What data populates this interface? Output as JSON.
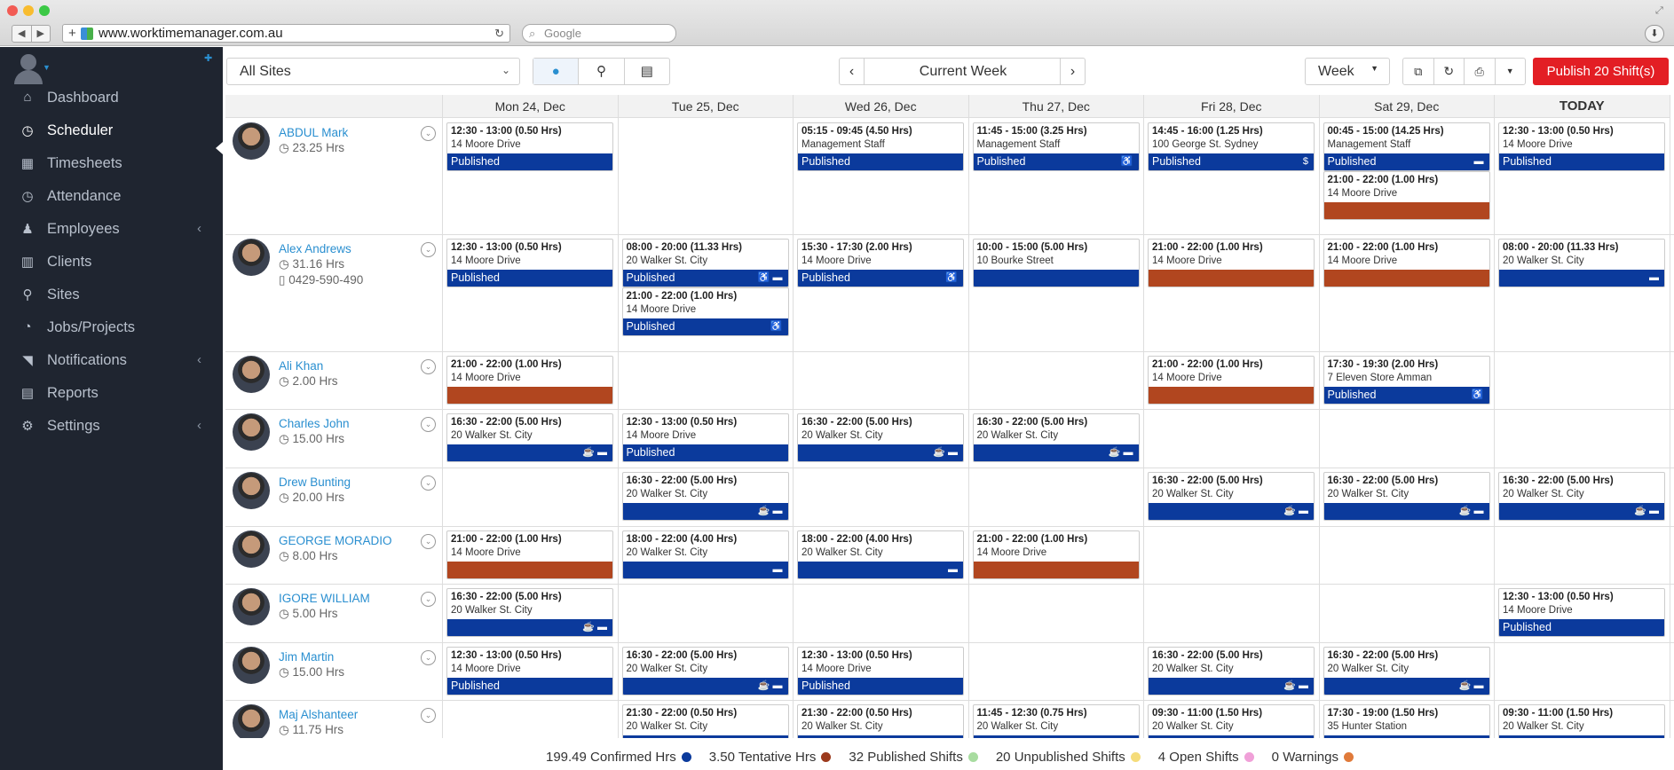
{
  "browser": {
    "url": "www.worktimemanager.com.au",
    "search_placeholder": "Google"
  },
  "sidebar": {
    "items": [
      {
        "label": "Dashboard",
        "icon": "dashboard-icon",
        "glyph": "⌂",
        "active": false,
        "chevron": false
      },
      {
        "label": "Scheduler",
        "icon": "clock-icon",
        "glyph": "◷",
        "active": true,
        "chevron": false
      },
      {
        "label": "Timesheets",
        "icon": "calendar-icon",
        "glyph": "▦",
        "active": false,
        "chevron": false
      },
      {
        "label": "Attendance",
        "icon": "clock-icon",
        "glyph": "◷",
        "active": false,
        "chevron": false
      },
      {
        "label": "Employees",
        "icon": "person-icon",
        "glyph": "♟",
        "active": false,
        "chevron": true
      },
      {
        "label": "Clients",
        "icon": "bank-icon",
        "glyph": "▥",
        "active": false,
        "chevron": false
      },
      {
        "label": "Sites",
        "icon": "map-pin-icon",
        "glyph": "⚲",
        "active": false,
        "chevron": false
      },
      {
        "label": "Jobs/Projects",
        "icon": "dashboard-icon",
        "glyph": "◔",
        "active": false,
        "chevron": false
      },
      {
        "label": "Notifications",
        "icon": "rss-icon",
        "glyph": "◥",
        "active": false,
        "chevron": true
      },
      {
        "label": "Reports",
        "icon": "grid-icon",
        "glyph": "▤",
        "active": false,
        "chevron": false
      },
      {
        "label": "Settings",
        "icon": "gear-icon",
        "glyph": "⚙",
        "active": false,
        "chevron": true
      }
    ]
  },
  "toolbar": {
    "sites": "All Sites",
    "week_nav": "Current Week",
    "view": "Week",
    "publish": "Publish 20 Shift(s)"
  },
  "days": [
    "Mon 24, Dec",
    "Tue 25, Dec",
    "Wed 26, Dec",
    "Thu 27, Dec",
    "Fri 28, Dec",
    "Sat 29, Dec",
    "TODAY"
  ],
  "employees": [
    {
      "name": "ABDUL Mark",
      "hours": "23.25 Hrs",
      "phone": ""
    },
    {
      "name": "Alex Andrews",
      "hours": "31.16 Hrs",
      "phone": "0429-590-490"
    },
    {
      "name": "Ali Khan",
      "hours": "2.00 Hrs",
      "phone": ""
    },
    {
      "name": "Charles John",
      "hours": "15.00 Hrs",
      "phone": ""
    },
    {
      "name": "Drew Bunting",
      "hours": "20.00 Hrs",
      "phone": ""
    },
    {
      "name": "GEORGE MORADIO",
      "hours": "8.00 Hrs",
      "phone": ""
    },
    {
      "name": "IGORE WILLIAM",
      "hours": "5.00 Hrs",
      "phone": ""
    },
    {
      "name": "Jim Martin",
      "hours": "15.00 Hrs",
      "phone": ""
    },
    {
      "name": "Maj Alshanteer",
      "hours": "11.75 Hrs",
      "phone": ""
    }
  ],
  "shifts": [
    {
      "row": 0,
      "day": 0,
      "slot": 0,
      "time": "12:30 - 13:00 (0.50 Hrs)",
      "loc": "14 Moore Drive",
      "status": "Published",
      "color": "blue",
      "icons": ""
    },
    {
      "row": 0,
      "day": 2,
      "slot": 0,
      "time": "05:15 - 09:45 (4.50 Hrs)",
      "loc": "Management Staff",
      "status": "Published",
      "color": "blue",
      "icons": ""
    },
    {
      "row": 0,
      "day": 3,
      "slot": 0,
      "time": "11:45 - 15:00 (3.25 Hrs)",
      "loc": "Management Staff",
      "status": "Published",
      "color": "blue",
      "icons": "♿"
    },
    {
      "row": 0,
      "day": 4,
      "slot": 0,
      "time": "14:45 - 16:00 (1.25 Hrs)",
      "loc": "100 George St. Sydney",
      "status": "Published",
      "color": "blue",
      "icons": "$"
    },
    {
      "row": 0,
      "day": 5,
      "slot": 0,
      "time": "00:45 - 15:00 (14.25 Hrs)",
      "loc": "Management Staff",
      "status": "Published",
      "color": "blue",
      "icons": "▬"
    },
    {
      "row": 0,
      "day": 5,
      "slot": 1,
      "time": "21:00 - 22:00 (1.00 Hrs)",
      "loc": "14 Moore Drive",
      "status": "",
      "color": "brown",
      "icons": ""
    },
    {
      "row": 0,
      "day": 6,
      "slot": 0,
      "time": "12:30 - 13:00 (0.50 Hrs)",
      "loc": "14 Moore Drive",
      "status": "Published",
      "color": "blue",
      "icons": ""
    },
    {
      "row": 1,
      "day": 0,
      "slot": 0,
      "time": "12:30 - 13:00 (0.50 Hrs)",
      "loc": "14 Moore Drive",
      "status": "Published",
      "color": "blue",
      "icons": ""
    },
    {
      "row": 1,
      "day": 1,
      "slot": 0,
      "time": "08:00 - 20:00 (11.33 Hrs)",
      "loc": "20 Walker St. City",
      "status": "Published",
      "color": "blue",
      "icons": "♿ ▬"
    },
    {
      "row": 1,
      "day": 1,
      "slot": 1,
      "time": "21:00 - 22:00 (1.00 Hrs)",
      "loc": "14 Moore Drive",
      "status": "Published",
      "color": "blue",
      "icons": "♿"
    },
    {
      "row": 1,
      "day": 2,
      "slot": 0,
      "time": "15:30 - 17:30 (2.00 Hrs)",
      "loc": "14 Moore Drive",
      "status": "Published",
      "color": "blue",
      "icons": "♿"
    },
    {
      "row": 1,
      "day": 3,
      "slot": 0,
      "time": "10:00 - 15:00 (5.00 Hrs)",
      "loc": "10 Bourke Street",
      "status": "",
      "color": "blue",
      "icons": ""
    },
    {
      "row": 1,
      "day": 4,
      "slot": 0,
      "time": "21:00 - 22:00 (1.00 Hrs)",
      "loc": "14 Moore Drive",
      "status": "",
      "color": "brown",
      "icons": ""
    },
    {
      "row": 1,
      "day": 5,
      "slot": 0,
      "time": "21:00 - 22:00 (1.00 Hrs)",
      "loc": "14 Moore Drive",
      "status": "",
      "color": "brown",
      "icons": ""
    },
    {
      "row": 1,
      "day": 6,
      "slot": 0,
      "time": "08:00 - 20:00 (11.33 Hrs)",
      "loc": "20 Walker St. City",
      "status": "",
      "color": "blue",
      "icons": "▬"
    },
    {
      "row": 2,
      "day": 0,
      "slot": 0,
      "time": "21:00 - 22:00 (1.00 Hrs)",
      "loc": "14 Moore Drive",
      "status": "",
      "color": "brown",
      "icons": ""
    },
    {
      "row": 2,
      "day": 4,
      "slot": 0,
      "time": "21:00 - 22:00 (1.00 Hrs)",
      "loc": "14 Moore Drive",
      "status": "",
      "color": "brown",
      "icons": ""
    },
    {
      "row": 2,
      "day": 5,
      "slot": 0,
      "time": "17:30 - 19:30 (2.00 Hrs)",
      "loc": "7 Eleven Store Amman",
      "status": "Published",
      "color": "blue",
      "icons": "♿"
    },
    {
      "row": 3,
      "day": 0,
      "slot": 0,
      "time": "16:30 - 22:00 (5.00 Hrs)",
      "loc": "20 Walker St. City",
      "status": "",
      "color": "blue",
      "icons": "☕ ▬"
    },
    {
      "row": 3,
      "day": 1,
      "slot": 0,
      "time": "12:30 - 13:00 (0.50 Hrs)",
      "loc": "14 Moore Drive",
      "status": "Published",
      "color": "blue",
      "icons": ""
    },
    {
      "row": 3,
      "day": 2,
      "slot": 0,
      "time": "16:30 - 22:00 (5.00 Hrs)",
      "loc": "20 Walker St. City",
      "status": "",
      "color": "blue",
      "icons": "☕ ▬"
    },
    {
      "row": 3,
      "day": 3,
      "slot": 0,
      "time": "16:30 - 22:00 (5.00 Hrs)",
      "loc": "20 Walker St. City",
      "status": "",
      "color": "blue",
      "icons": "☕ ▬"
    },
    {
      "row": 4,
      "day": 1,
      "slot": 0,
      "time": "16:30 - 22:00 (5.00 Hrs)",
      "loc": "20 Walker St. City",
      "status": "",
      "color": "blue",
      "icons": "☕ ▬"
    },
    {
      "row": 4,
      "day": 4,
      "slot": 0,
      "time": "16:30 - 22:00 (5.00 Hrs)",
      "loc": "20 Walker St. City",
      "status": "",
      "color": "blue",
      "icons": "☕ ▬"
    },
    {
      "row": 4,
      "day": 5,
      "slot": 0,
      "time": "16:30 - 22:00 (5.00 Hrs)",
      "loc": "20 Walker St. City",
      "status": "",
      "color": "blue",
      "icons": "☕ ▬"
    },
    {
      "row": 4,
      "day": 6,
      "slot": 0,
      "time": "16:30 - 22:00 (5.00 Hrs)",
      "loc": "20 Walker St. City",
      "status": "",
      "color": "blue",
      "icons": "☕ ▬"
    },
    {
      "row": 5,
      "day": 0,
      "slot": 0,
      "time": "21:00 - 22:00 (1.00 Hrs)",
      "loc": "14 Moore Drive",
      "status": "",
      "color": "brown",
      "icons": ""
    },
    {
      "row": 5,
      "day": 1,
      "slot": 0,
      "time": "18:00 - 22:00 (4.00 Hrs)",
      "loc": "20 Walker St. City",
      "status": "",
      "color": "blue",
      "icons": "▬"
    },
    {
      "row": 5,
      "day": 2,
      "slot": 0,
      "time": "18:00 - 22:00 (4.00 Hrs)",
      "loc": "20 Walker St. City",
      "status": "",
      "color": "blue",
      "icons": "▬"
    },
    {
      "row": 5,
      "day": 3,
      "slot": 0,
      "time": "21:00 - 22:00 (1.00 Hrs)",
      "loc": "14 Moore Drive",
      "status": "",
      "color": "brown",
      "icons": ""
    },
    {
      "row": 6,
      "day": 0,
      "slot": 0,
      "time": "16:30 - 22:00 (5.00 Hrs)",
      "loc": "20 Walker St. City",
      "status": "",
      "color": "blue",
      "icons": "☕ ▬"
    },
    {
      "row": 6,
      "day": 6,
      "slot": 0,
      "time": "12:30 - 13:00 (0.50 Hrs)",
      "loc": "14 Moore Drive",
      "status": "Published",
      "color": "blue",
      "icons": ""
    },
    {
      "row": 7,
      "day": 0,
      "slot": 0,
      "time": "12:30 - 13:00 (0.50 Hrs)",
      "loc": "14 Moore Drive",
      "status": "Published",
      "color": "blue",
      "icons": ""
    },
    {
      "row": 7,
      "day": 1,
      "slot": 0,
      "time": "16:30 - 22:00 (5.00 Hrs)",
      "loc": "20 Walker St. City",
      "status": "",
      "color": "blue",
      "icons": "☕ ▬"
    },
    {
      "row": 7,
      "day": 2,
      "slot": 0,
      "time": "12:30 - 13:00 (0.50 Hrs)",
      "loc": "14 Moore Drive",
      "status": "Published",
      "color": "blue",
      "icons": ""
    },
    {
      "row": 7,
      "day": 4,
      "slot": 0,
      "time": "16:30 - 22:00 (5.00 Hrs)",
      "loc": "20 Walker St. City",
      "status": "",
      "color": "blue",
      "icons": "☕ ▬"
    },
    {
      "row": 7,
      "day": 5,
      "slot": 0,
      "time": "16:30 - 22:00 (5.00 Hrs)",
      "loc": "20 Walker St. City",
      "status": "",
      "color": "blue",
      "icons": "☕ ▬"
    },
    {
      "row": 8,
      "day": 1,
      "slot": 0,
      "time": "21:30 - 22:00 (0.50 Hrs)",
      "loc": "20 Walker St. City",
      "status": "",
      "color": "blue",
      "icons": ""
    },
    {
      "row": 8,
      "day": 2,
      "slot": 0,
      "time": "21:30 - 22:00 (0.50 Hrs)",
      "loc": "20 Walker St. City",
      "status": "",
      "color": "blue",
      "icons": ""
    },
    {
      "row": 8,
      "day": 3,
      "slot": 0,
      "time": "11:45 - 12:30 (0.75 Hrs)",
      "loc": "20 Walker St. City",
      "status": "",
      "color": "blue",
      "icons": ""
    },
    {
      "row": 8,
      "day": 4,
      "slot": 0,
      "time": "09:30 - 11:00 (1.50 Hrs)",
      "loc": "20 Walker St. City",
      "status": "",
      "color": "blue",
      "icons": ""
    },
    {
      "row": 8,
      "day": 5,
      "slot": 0,
      "time": "17:30 - 19:00 (1.50 Hrs)",
      "loc": "35 Hunter Station",
      "status": "",
      "color": "blue",
      "icons": ""
    },
    {
      "row": 8,
      "day": 6,
      "slot": 0,
      "time": "09:30 - 11:00 (1.50 Hrs)",
      "loc": "20 Walker St. City",
      "status": "",
      "color": "blue",
      "icons": ""
    }
  ],
  "footer": [
    {
      "value": "199.49",
      "label": "Confirmed Hrs",
      "color": "#0b3a9c"
    },
    {
      "value": "3.50",
      "label": "Tentative Hrs",
      "color": "#9c3a1c"
    },
    {
      "value": "32",
      "label": "Published Shifts",
      "color": "#a8dca0"
    },
    {
      "value": "20",
      "label": "Unpublished Shifts",
      "color": "#f5dc7a"
    },
    {
      "value": "4",
      "label": "Open Shifts",
      "color": "#f0a0d8"
    },
    {
      "value": "0",
      "label": "Warnings",
      "color": "#e07a3a"
    }
  ],
  "colors": {
    "blue": "#0b3a9c",
    "brown": "#b1461f",
    "publish": "#e31e24"
  }
}
